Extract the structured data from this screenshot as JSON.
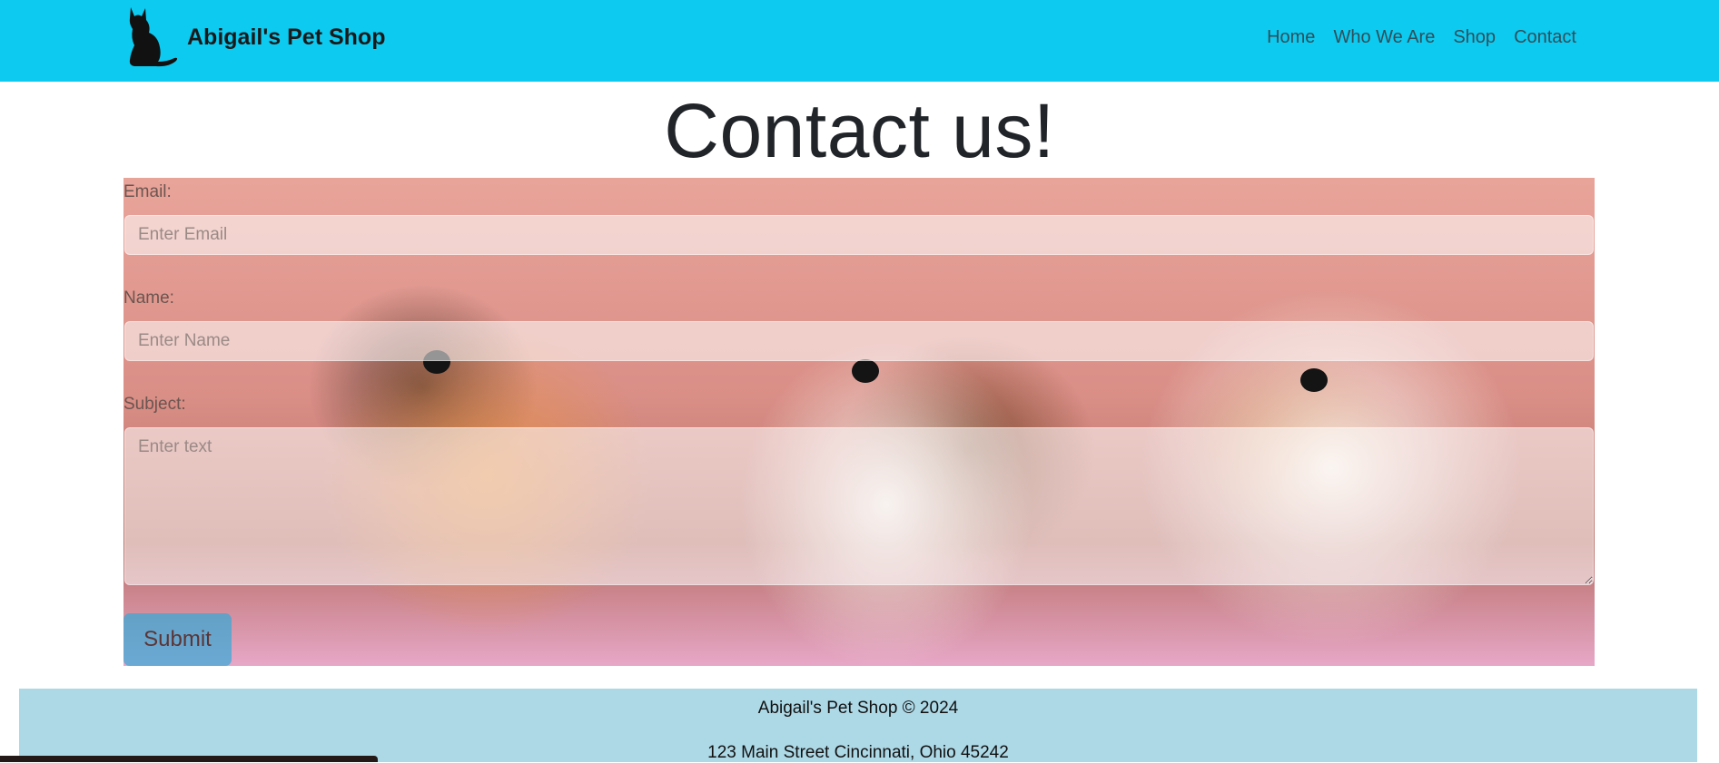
{
  "brand": {
    "name": "Abigail's Pet Shop",
    "logo_icon": "cat-silhouette-icon"
  },
  "nav": {
    "items": [
      {
        "label": "Home"
      },
      {
        "label": "Who We Are"
      },
      {
        "label": "Shop"
      },
      {
        "label": "Contact"
      }
    ]
  },
  "page": {
    "title": "Contact us!"
  },
  "form": {
    "email": {
      "label": "Email:",
      "placeholder": "Enter Email",
      "value": ""
    },
    "name": {
      "label": "Name:",
      "placeholder": "Enter Name",
      "value": ""
    },
    "subject": {
      "label": "Subject:",
      "placeholder": "Enter text",
      "value": ""
    },
    "submit_label": "Submit"
  },
  "footer": {
    "copyright": "Abigail's Pet Shop © 2024",
    "address": "123 Main Street Cincinnati, Ohio 45242"
  },
  "colors": {
    "navbar": "#0dcaf0",
    "footer": "#add8e6",
    "submit": "#28aadc"
  }
}
